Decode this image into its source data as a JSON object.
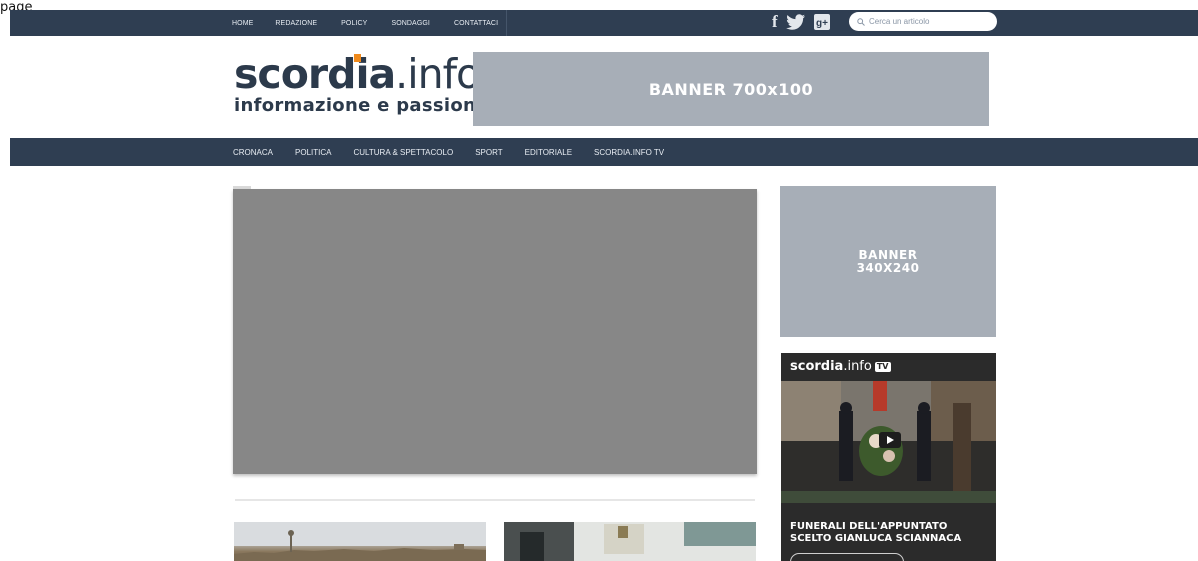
{
  "page_label": "page",
  "topbar": {
    "nav": [
      "HOME",
      "REDAZIONE",
      "POLICY",
      "SONDAGGI",
      "CONTATTACI"
    ],
    "social_icons": [
      "facebook-icon",
      "twitter-icon",
      "google-plus-icon"
    ],
    "search_placeholder": "Cerca un articolo"
  },
  "logo": {
    "main_bold": "scordia",
    "main_light": ".info",
    "tagline": "informazione e passione"
  },
  "banner_top": "BANNER 700x100",
  "mainnav": [
    "CRONACA",
    "POLITICA",
    "CULTURA & SPETTACOLO",
    "SPORT",
    "EDITORIALE",
    "SCORDIA.INFO TV"
  ],
  "sidebar": {
    "banner_line1": "BANNER",
    "banner_line2": "340X240",
    "tv": {
      "logo_bold": "scordia",
      "logo_light": ".info",
      "badge": "TV",
      "title": "FUNERALI DELL'APPUNTATO SCELTO GIANLUCA SCIANNACA"
    }
  },
  "colors": {
    "navbar": "#2f3e52",
    "banner": "#a7aeb7",
    "accent": "#f08a1c"
  }
}
